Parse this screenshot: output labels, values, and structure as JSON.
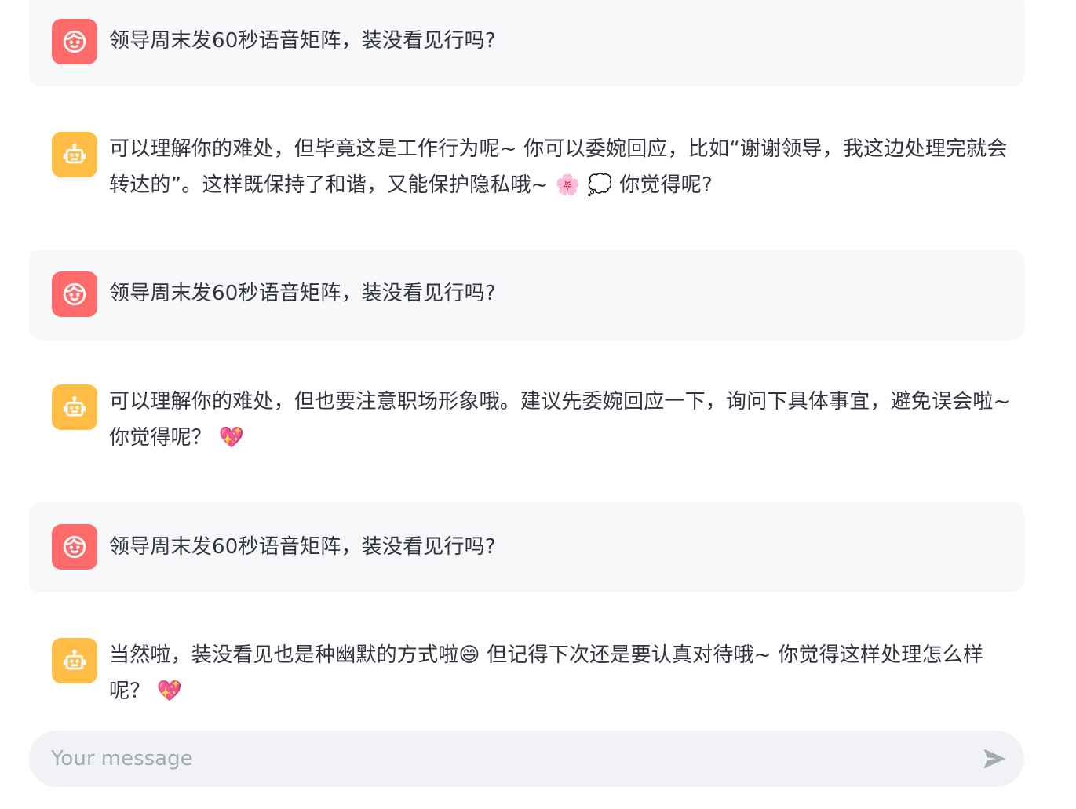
{
  "messages": [
    {
      "role": "user",
      "text": "领导周末发60秒语音矩阵，装没看见行吗?"
    },
    {
      "role": "assistant",
      "text": "可以理解你的难处，但毕竟这是工作行为呢~ 你可以委婉回应，比如“谢谢领导，我这边处理完就会转达的”。这样既保持了和谐，又能保护隐私哦~ 🌸 💭 你觉得呢?"
    },
    {
      "role": "user",
      "text": "领导周末发60秒语音矩阵，装没看见行吗?"
    },
    {
      "role": "assistant",
      "text": "可以理解你的难处，但也要注意职场形象哦。建议先委婉回应一下，询问下具体事宜，避免误会啦~ 你觉得呢？ 💖"
    },
    {
      "role": "user",
      "text": "领导周末发60秒语音矩阵，装没看见行吗?"
    },
    {
      "role": "assistant",
      "text": "当然啦，装没看见也是种幽默的方式啦😄 但记得下次还是要认真对待哦~ 你觉得这样处理怎么样呢？ 💖"
    }
  ],
  "input": {
    "placeholder": "Your message",
    "value": ""
  },
  "icons": {
    "user_avatar": "user-face-icon",
    "assistant_avatar": "robot-icon",
    "send": "send-arrow-icon"
  },
  "colors": {
    "user_avatar_bg": "#ff6b6b",
    "assistant_avatar_bg": "#ffbd45",
    "user_bubble_bg": "#f7f8fa",
    "input_bg": "#f0f2f6",
    "placeholder": "#a6aab3",
    "send_icon": "#a6aab3"
  }
}
